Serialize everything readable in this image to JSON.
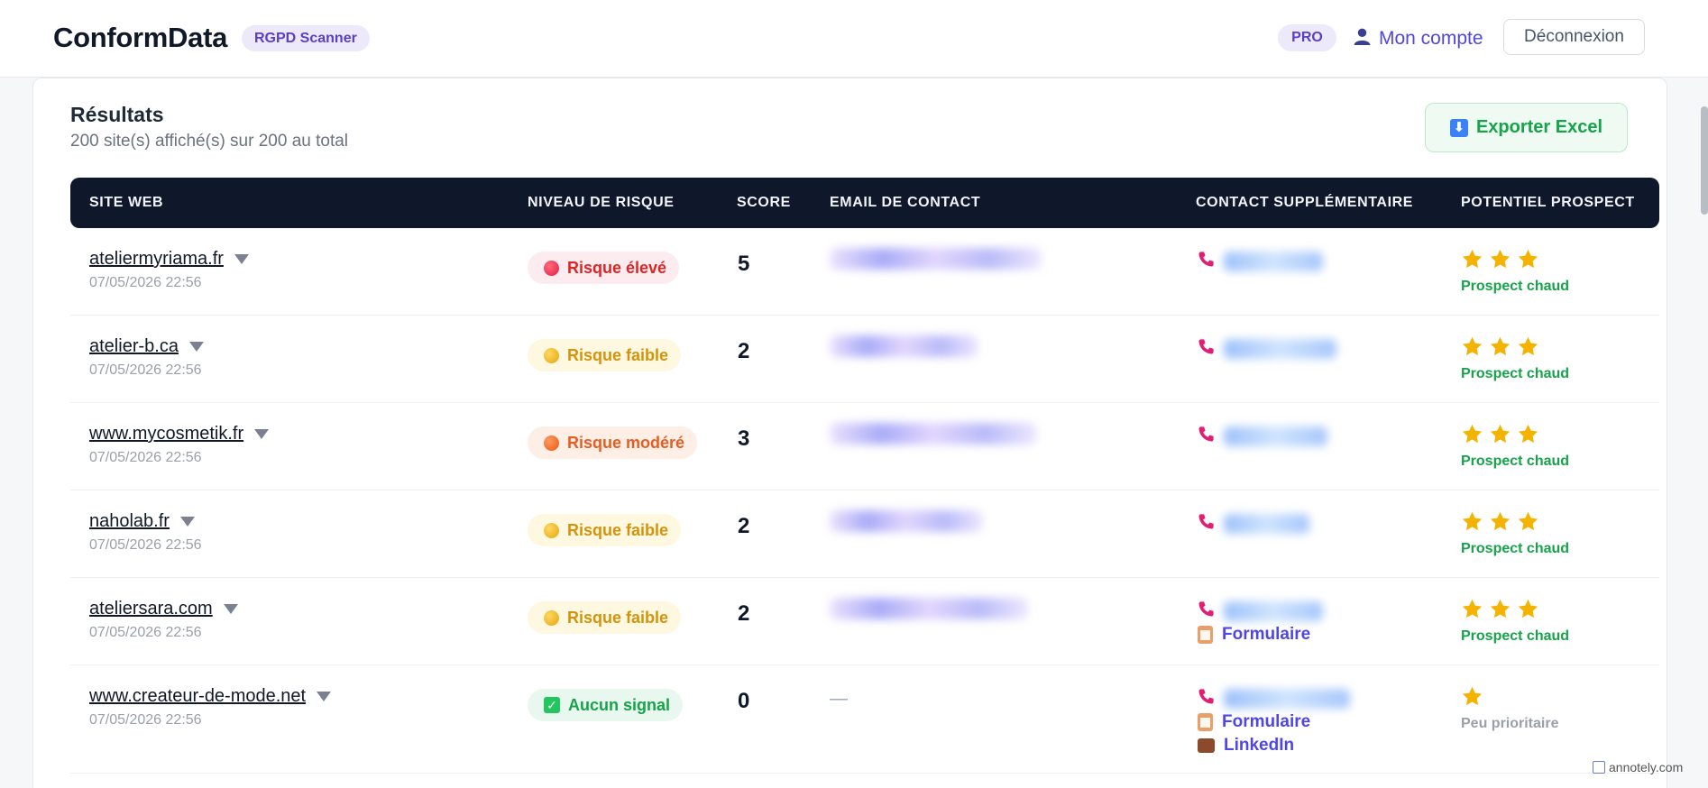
{
  "header": {
    "brand": "ConformData",
    "tag": "RGPD Scanner",
    "plan_badge": "PRO",
    "account_label": "Mon compte",
    "logout_label": "Déconnexion"
  },
  "results": {
    "title": "Résultats",
    "subtitle": "200 site(s) affiché(s) sur 200 au total",
    "export_label": "Exporter Excel"
  },
  "table": {
    "columns": [
      "SITE WEB",
      "NIVEAU DE RISQUE",
      "SCORE",
      "EMAIL DE CONTACT",
      "CONTACT SUPPLÉMENTAIRE",
      "POTENTIEL PROSPECT"
    ],
    "rows": [
      {
        "site": "ateliermyriama.fr",
        "date": "07/05/2026 22:56",
        "risk": "Risque élevé",
        "score": "5",
        "email_hidden": true,
        "form": "",
        "linkedin": "",
        "stars": 3,
        "prospect": "Prospect chaud"
      },
      {
        "site": "atelier-b.ca",
        "date": "07/05/2026 22:56",
        "risk": "Risque faible",
        "score": "2",
        "email_hidden": true,
        "form": "",
        "linkedin": "",
        "stars": 3,
        "prospect": "Prospect chaud"
      },
      {
        "site": "www.mycosmetik.fr",
        "date": "07/05/2026 22:56",
        "risk": "Risque modéré",
        "score": "3",
        "email_hidden": true,
        "form": "",
        "linkedin": "",
        "stars": 3,
        "prospect": "Prospect chaud"
      },
      {
        "site": "naholab.fr",
        "date": "07/05/2026 22:56",
        "risk": "Risque faible",
        "score": "2",
        "email_hidden": true,
        "form": "",
        "linkedin": "",
        "stars": 3,
        "prospect": "Prospect chaud"
      },
      {
        "site": "ateliersara.com",
        "date": "07/05/2026 22:56",
        "risk": "Risque faible",
        "score": "2",
        "email_hidden": true,
        "form": "Formulaire",
        "linkedin": "",
        "stars": 3,
        "prospect": "Prospect chaud"
      },
      {
        "site": "www.createur-de-mode.net",
        "date": "07/05/2026 22:56",
        "risk": "Aucun signal",
        "score": "0",
        "email": "—",
        "form": "Formulaire",
        "linkedin": "LinkedIn",
        "stars": 1,
        "prospect": "Peu prioritaire"
      }
    ]
  },
  "watermark": "annotely.com",
  "colors": {
    "accent": "#4f46e5",
    "header_bg": "#0f172a",
    "success": "#16a34a",
    "danger": "#dc2626",
    "warning": "#d4930b",
    "moderate": "#e75e23"
  }
}
